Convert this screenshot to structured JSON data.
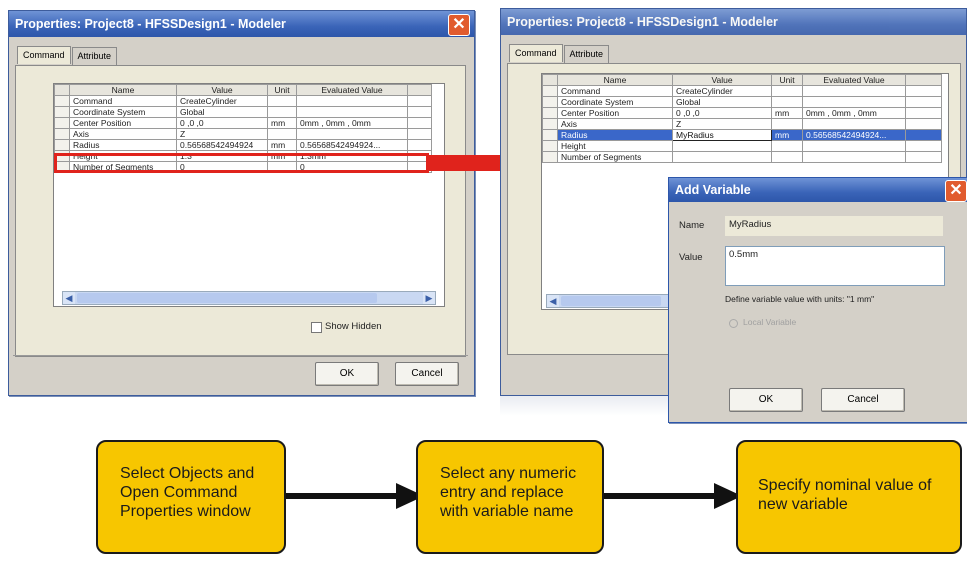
{
  "left_window": {
    "title": "Properties: Project8 - HFSSDesign1 - Modeler",
    "close_glyph": "✕",
    "tabs": [
      "Command",
      "Attribute"
    ],
    "columns": [
      "Name",
      "Value",
      "Unit",
      "Evaluated Value"
    ],
    "rows": [
      [
        "Command",
        "CreateCylinder",
        "",
        ""
      ],
      [
        "Coordinate System",
        "Global",
        "",
        ""
      ],
      [
        "Center Position",
        "0 ,0 ,0",
        "mm",
        "0mm , 0mm , 0mm"
      ],
      [
        "Axis",
        "Z",
        "",
        ""
      ],
      [
        "Radius",
        "0.56568542494924",
        "mm",
        "0.56568542494924..."
      ],
      [
        "Height",
        "1.3",
        "mm",
        "1.3mm"
      ],
      [
        "Number of Segments",
        "0",
        "",
        "0"
      ]
    ],
    "show_hidden_label": "Show Hidden",
    "ok_label": "OK",
    "cancel_label": "Cancel"
  },
  "right_window": {
    "title": "Properties: Project8 - HFSSDesign1 - Modeler",
    "tabs": [
      "Command",
      "Attribute"
    ],
    "columns": [
      "Name",
      "Value",
      "Unit",
      "Evaluated Value"
    ],
    "rows": [
      [
        "Command",
        "CreateCylinder",
        "",
        ""
      ],
      [
        "Coordinate System",
        "Global",
        "",
        ""
      ],
      [
        "Center Position",
        "0 ,0 ,0",
        "mm",
        "0mm , 0mm , 0mm"
      ],
      [
        "Axis",
        "Z",
        "",
        ""
      ],
      [
        "Radius",
        "MyRadius",
        "mm",
        "0.56568542494924..."
      ],
      [
        "Height",
        "",
        "",
        ""
      ],
      [
        "Number of Segments",
        "",
        "",
        ""
      ]
    ]
  },
  "add_variable": {
    "title": "Add Variable",
    "close_glyph": "✕",
    "name_label": "Name",
    "name_value": "MyRadius",
    "value_label": "Value",
    "value_value": "0.5mm",
    "hint": "Define variable value with units: \"1 mm\"",
    "local_variable_label": "Local Variable",
    "ok_label": "OK",
    "cancel_label": "Cancel"
  },
  "flow": {
    "step1": "Select Objects and Open Command Properties window",
    "step2": "Select any numeric entry and replace with variable name",
    "step3": "Specify nominal value of new variable"
  },
  "colors": {
    "highlight_red": "#e0231c",
    "flow_yellow": "#f7c600",
    "selection_blue": "#3a67c9"
  }
}
